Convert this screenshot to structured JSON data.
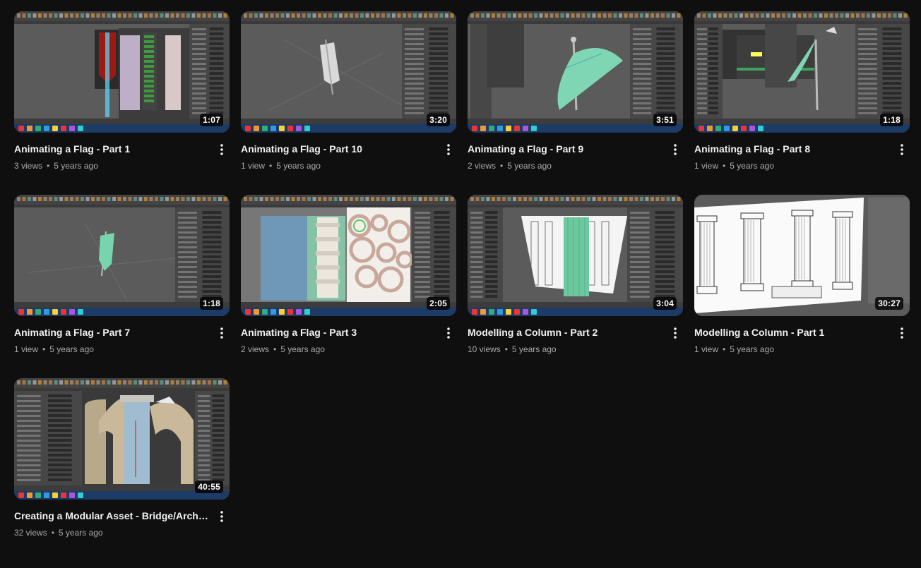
{
  "videos": [
    {
      "title": "Animating a Flag - Part 1",
      "views": "3 views",
      "age": "5 years ago",
      "duration": "1:07",
      "thumb": "flag-texture"
    },
    {
      "title": "Animating a Flag - Part 10",
      "views": "1 view",
      "age": "5 years ago",
      "duration": "3:20",
      "thumb": "flag-white"
    },
    {
      "title": "Animating a Flag - Part 9",
      "views": "2 views",
      "age": "5 years ago",
      "duration": "3:51",
      "thumb": "flag-green-wave"
    },
    {
      "title": "Animating a Flag - Part 8",
      "views": "1 view",
      "age": "5 years ago",
      "duration": "1:18",
      "thumb": "flag-green-pole"
    },
    {
      "title": "Animating a Flag - Part 7",
      "views": "1 view",
      "age": "5 years ago",
      "duration": "1:18",
      "thumb": "flag-green-small"
    },
    {
      "title": "Animating a Flag - Part 3",
      "views": "2 views",
      "age": "5 years ago",
      "duration": "2:05",
      "thumb": "flag-uv"
    },
    {
      "title": "Modelling a Column - Part 2",
      "views": "10 views",
      "age": "5 years ago",
      "duration": "3:04",
      "thumb": "column-green"
    },
    {
      "title": "Modelling a Column - Part 1",
      "views": "1 view",
      "age": "5 years ago",
      "duration": "30:27",
      "thumb": "column-sketch"
    },
    {
      "title": "Creating a Modular Asset - Bridge/Archway",
      "views": "32 views",
      "age": "5 years ago",
      "duration": "40:55",
      "thumb": "archway"
    }
  ],
  "separator": "•",
  "icons": {
    "more": "more-vert-icon"
  },
  "colors": {
    "background": "#0f0f0f",
    "title": "#f1f1f1",
    "meta": "#aaaaaa"
  }
}
